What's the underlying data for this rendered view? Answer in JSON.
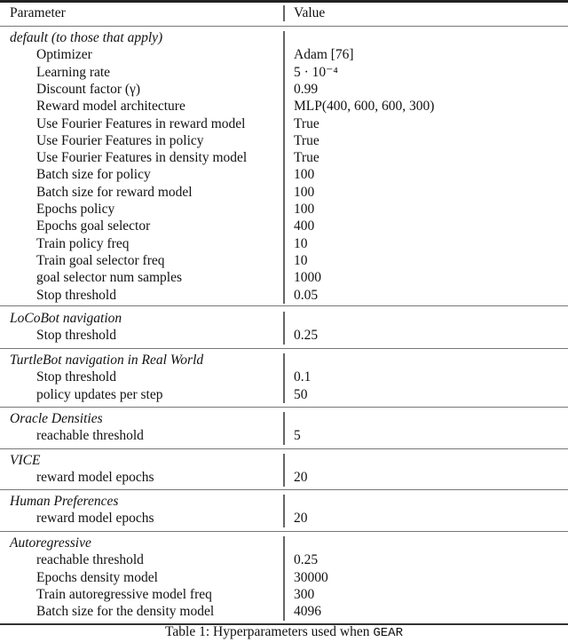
{
  "header": {
    "parameter": "Parameter",
    "value": "Value"
  },
  "sections": [
    {
      "title": "default (to those that apply)",
      "rows": [
        {
          "param": "Optimizer",
          "value": "Adam [76]"
        },
        {
          "param": "Learning rate",
          "value": "5 · 10⁻⁴"
        },
        {
          "param": "Discount factor (γ)",
          "value": "0.99"
        },
        {
          "param": "Reward model architecture",
          "value": "MLP(400, 600, 600, 300)"
        },
        {
          "param": "Use Fourier Features in reward model",
          "value": "True"
        },
        {
          "param": "Use Fourier Features in policy",
          "value": "True"
        },
        {
          "param": "Use Fourier Features in density model",
          "value": "True"
        },
        {
          "param": "Batch size for policy",
          "value": "100"
        },
        {
          "param": "Batch size for reward model",
          "value": "100"
        },
        {
          "param": "Epochs policy",
          "value": "100"
        },
        {
          "param": "Epochs goal selector",
          "value": "400"
        },
        {
          "param": "Train policy freq",
          "value": "10"
        },
        {
          "param": "Train goal selector freq",
          "value": "10"
        },
        {
          "param": "goal selector num samples",
          "value": "1000"
        },
        {
          "param": "Stop threshold",
          "value": "0.05"
        }
      ]
    },
    {
      "title": "LoCoBot navigation",
      "rows": [
        {
          "param": "Stop threshold",
          "value": "0.25"
        }
      ]
    },
    {
      "title": "TurtleBot navigation in Real World",
      "rows": [
        {
          "param": "Stop threshold",
          "value": "0.1"
        },
        {
          "param": "policy updates per step",
          "value": "50"
        }
      ]
    },
    {
      "title": "Oracle Densities",
      "rows": [
        {
          "param": "reachable threshold",
          "value": "5"
        }
      ]
    },
    {
      "title": "VICE",
      "rows": [
        {
          "param": "reward model epochs",
          "value": "20"
        }
      ]
    },
    {
      "title": "Human Preferences",
      "rows": [
        {
          "param": "reward model epochs",
          "value": "20"
        }
      ]
    },
    {
      "title": "Autoregressive",
      "rows": [
        {
          "param": "reachable threshold",
          "value": "0.25"
        },
        {
          "param": "Epochs density model",
          "value": "30000"
        },
        {
          "param": "Train autoregressive model freq",
          "value": "300"
        },
        {
          "param": "Batch size for the density model",
          "value": "4096"
        }
      ]
    }
  ],
  "caption": {
    "prefix": "Table 1: Hyperparameters used when ",
    "code": "GEAR"
  }
}
